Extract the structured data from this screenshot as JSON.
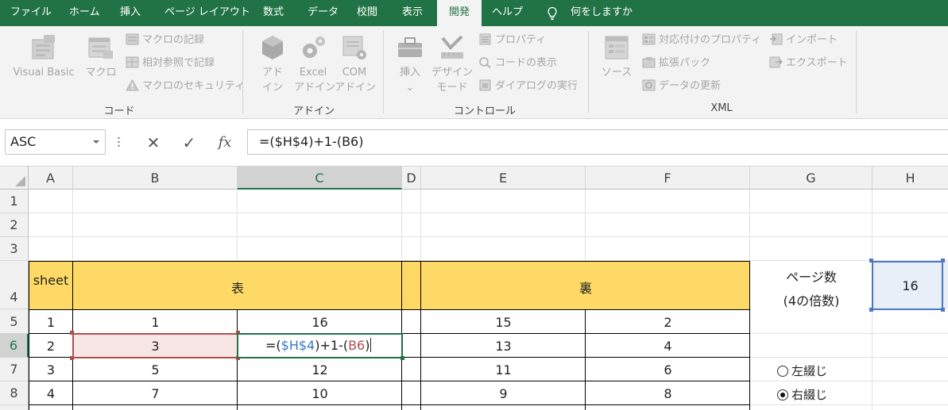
{
  "tabs": [
    "ファイル",
    "ホーム",
    "挿入",
    "ページ レイアウト",
    "数式",
    "データ",
    "校閲",
    "表示",
    "開発",
    "ヘルプ"
  ],
  "tell_me": "何をしますか",
  "ribbon": {
    "code_group": {
      "label": "コード",
      "visual_basic": "Visual Basic",
      "macro": "マクロ",
      "record_macro": "マクロの記録",
      "relative_ref": "相対参照で記録",
      "macro_security": "マクロのセキュリティ"
    },
    "addin_group": {
      "label": "アドイン",
      "addin_line1": "アド",
      "addin_line2": "イン",
      "excel_addin_line1": "Excel",
      "excel_addin_line2": "アドイン",
      "com_addin_line1": "COM",
      "com_addin_line2": "アドイン"
    },
    "control_group": {
      "label": "コントロール",
      "insert": "挿入",
      "insert_arrow": "⌄",
      "design_mode_line1": "デザイン",
      "design_mode_line2": "モード",
      "properties": "プロパティ",
      "view_code": "コードの表示",
      "run_dialog": "ダイアログの実行"
    },
    "xml_group": {
      "label": "XML",
      "source": "ソース",
      "map_properties": "対応付けのプロパティ",
      "expansion_packs": "拡張パック",
      "refresh_data": "データの更新",
      "import": "インポート",
      "export": "エクスポート"
    }
  },
  "formula_bar": {
    "name_box": "ASC",
    "cancel": "✕",
    "enter": "✓",
    "fx": "fx",
    "formula": "=($H$4)+1-(B6)"
  },
  "columns": [
    "A",
    "B",
    "C",
    "D",
    "E",
    "F",
    "G",
    "H"
  ],
  "rows": [
    "1",
    "2",
    "3",
    "4",
    "5",
    "6",
    "7",
    "8"
  ],
  "sheet": {
    "header_sheet": "sheet",
    "header_front": "表",
    "header_back": "裏",
    "page_count_label_1": "ページ数",
    "page_count_label_2": "(4の倍数)",
    "page_count_value": "16",
    "data_rows": [
      {
        "a": "1",
        "b": "1",
        "c": "16",
        "e": "15",
        "f": "2"
      },
      {
        "a": "2",
        "b": "3",
        "c": "",
        "e": "13",
        "f": "4"
      },
      {
        "a": "3",
        "b": "5",
        "c": "12",
        "e": "11",
        "f": "6"
      },
      {
        "a": "4",
        "b": "7",
        "c": "10",
        "e": "9",
        "f": "8"
      }
    ],
    "editing_formula": {
      "eq": "=(",
      "ref1": "$H$4",
      "mid": ")+1-(",
      "ref2": "B6",
      "end": ")"
    },
    "radio_left": "左綴じ",
    "radio_right": "右綴じ",
    "radio_right_selected": true
  },
  "colors": {
    "accent": "#217346",
    "header_fill": "#ffd966",
    "h4_fill": "#e9eff8"
  }
}
